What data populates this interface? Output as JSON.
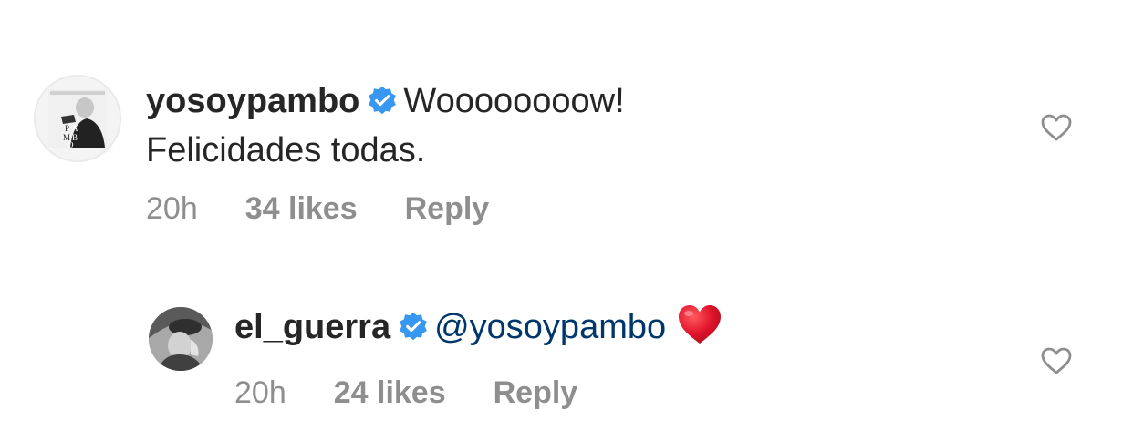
{
  "comments": [
    {
      "avatar_icon": "profile-photo-pambo",
      "avatar_letters": [
        "P",
        "A",
        "M",
        "B",
        "O"
      ],
      "username": "yosoypambo",
      "verified": true,
      "text_line1": "Woooooooow!",
      "text_line2": "Felicidades todas.",
      "time": "20h",
      "likes": "34 likes",
      "reply_label": "Reply",
      "like_icon": "heart-outline-icon"
    },
    {
      "avatar_icon": "profile-photo-el-guerra",
      "username": "el_guerra",
      "verified": true,
      "mention": "@yosoypambo",
      "emoji": "red-heart",
      "time": "20h",
      "likes": "24 likes",
      "reply_label": "Reply",
      "like_icon": "heart-outline-icon"
    }
  ],
  "colors": {
    "text": "#262626",
    "secondary": "#8e8e8e",
    "verified": "#3897f0",
    "mention": "#00376b",
    "emoji_heart": "#e0142b"
  }
}
